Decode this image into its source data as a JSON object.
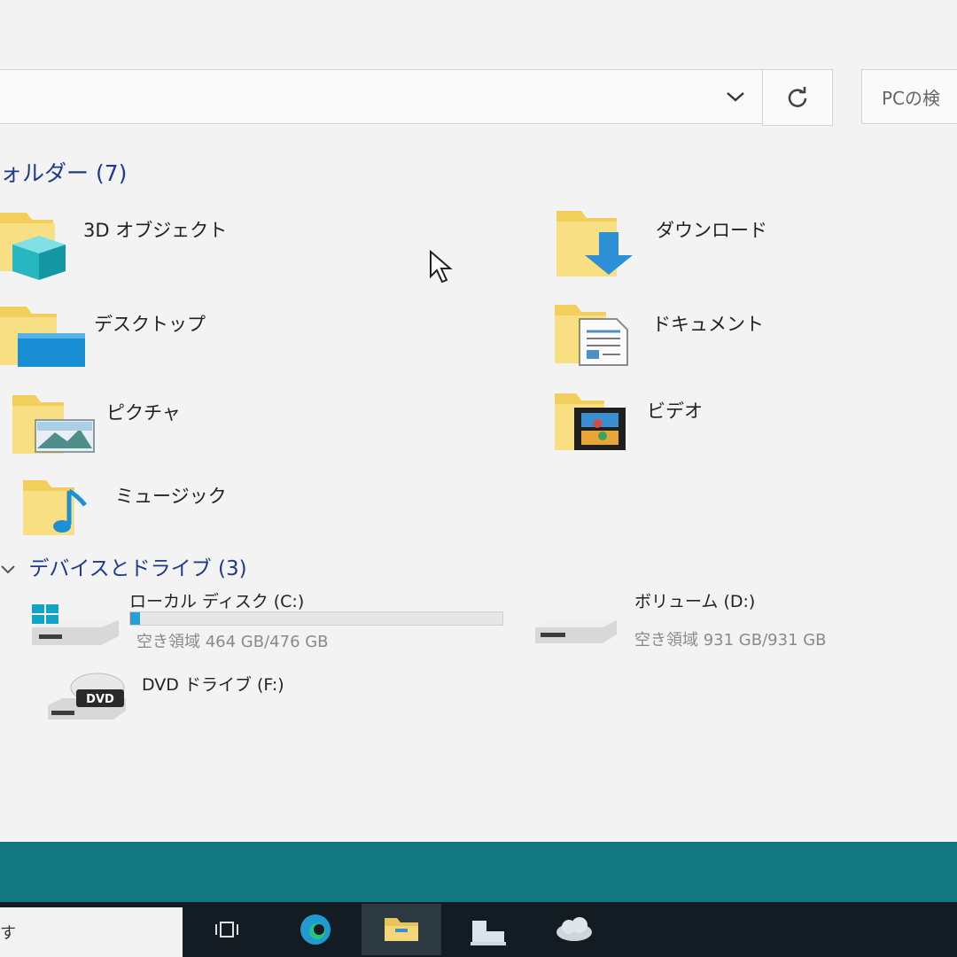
{
  "toolbar": {
    "dropdown_glyph": "⌄",
    "refresh_glyph": "↻",
    "search_placeholder": "PCの検"
  },
  "folders": {
    "header": "ォルダー (7)",
    "items": [
      {
        "label": "3D オブジェクト",
        "icon": "3d-objects-icon"
      },
      {
        "label": "ダウンロード",
        "icon": "download-icon"
      },
      {
        "label": "デスクトップ",
        "icon": "desktop-icon"
      },
      {
        "label": "ドキュメント",
        "icon": "document-icon"
      },
      {
        "label": "ピクチャ",
        "icon": "picture-icon"
      },
      {
        "label": "ビデオ",
        "icon": "video-icon"
      },
      {
        "label": "ミュージック",
        "icon": "music-icon"
      }
    ]
  },
  "devices": {
    "header": "デバイスとドライブ (3)",
    "chevron": "⌄",
    "drives": [
      {
        "name": "ローカル ディスク (C:)",
        "free": "空き領域 464 GB/476 GB",
        "used_fraction": 0.0252,
        "icon": "windows-drive-icon"
      },
      {
        "name": "ボリューム (D:)",
        "free": "空き領域 931 GB/931 GB",
        "icon": "hard-drive-icon"
      },
      {
        "name": "DVD ドライブ (F:)",
        "icon": "dvd-drive-icon",
        "dvd_text": "DVD"
      }
    ]
  },
  "taskbar": {
    "search_text": "す",
    "buttons": [
      "task-view-icon",
      "edge-icon",
      "file-explorer-icon",
      "store-icon",
      "cloud-icon"
    ]
  },
  "colors": {
    "accent": "#26a0da",
    "folder": "#f5d774",
    "header": "#1f3a8c",
    "taskbar": "#131c22",
    "teal": "#11787f"
  }
}
